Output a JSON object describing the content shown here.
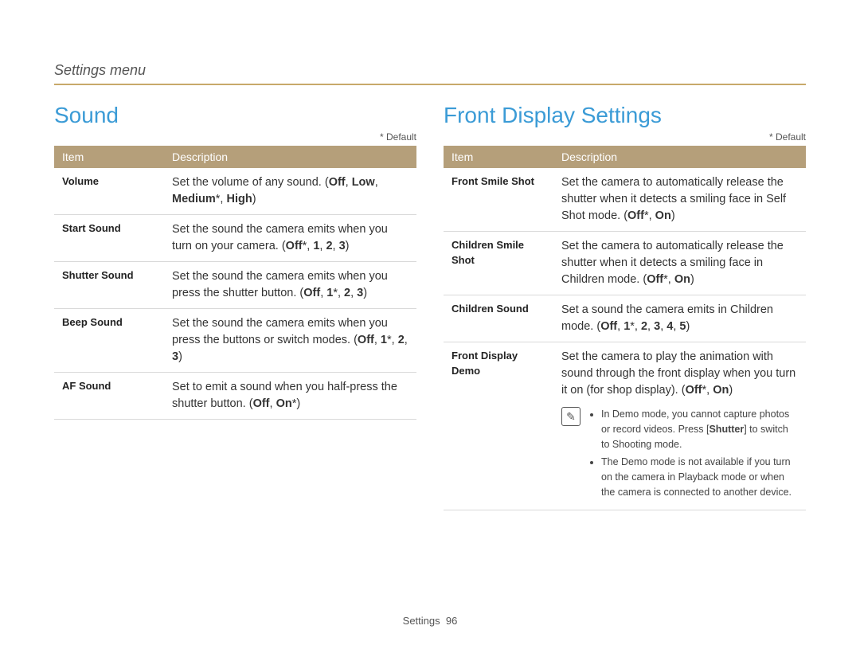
{
  "breadcrumb": "Settings menu",
  "default_note": "* Default",
  "table_headers": {
    "item": "Item",
    "description": "Description"
  },
  "left": {
    "title": "Sound",
    "rows": [
      {
        "item": "Volume",
        "desc_plain": "Set the volume of any sound. ",
        "opts_html": "(<b>Off</b>, <b>Low</b>, <b>Medium</b>*, <b>High</b>)"
      },
      {
        "item": "Start Sound",
        "desc_plain": "Set the sound the camera emits when you turn on your camera. ",
        "opts_html": "(<b>Off</b>*, <b>1</b>, <b>2</b>, <b>3</b>)"
      },
      {
        "item": "Shutter Sound",
        "desc_plain": "Set the sound the camera emits when you press the shutter button. ",
        "opts_html": "(<b>Off</b>, <b>1</b>*, <b>2</b>, <b>3</b>)"
      },
      {
        "item": "Beep Sound",
        "desc_plain": "Set the sound the camera emits when you press the buttons or switch modes. ",
        "opts_html": "(<b>Off</b>, <b>1</b>*, <b>2</b>, <b>3</b>)"
      },
      {
        "item": "AF Sound",
        "desc_plain": "Set to emit a sound when you half-press the shutter button. ",
        "opts_html": "(<b>Off</b>, <b>On</b>*)"
      }
    ]
  },
  "right": {
    "title": "Front Display Settings",
    "rows": [
      {
        "item": "Front Smile Shot",
        "desc_plain": "Set the camera to automatically release the shutter when it detects a smiling face in Self Shot mode. ",
        "opts_html": "(<b>Off</b>*, <b>On</b>)"
      },
      {
        "item": "Children Smile Shot",
        "desc_plain": "Set the camera to automatically release the shutter when it detects a smiling face in Children mode. ",
        "opts_html": "(<b>Off</b>*, <b>On</b>)"
      },
      {
        "item": "Children Sound",
        "desc_plain": "Set a sound the camera emits in Children mode. ",
        "opts_html": "(<b>Off</b>, <b>1</b>*, <b>2</b>, <b>3</b>, <b>4</b>, <b>5</b>)"
      },
      {
        "item": "Front Display Demo",
        "desc_plain": "Set the camera to play the animation with sound through the front display when you turn it on (for shop display). ",
        "opts_html": "(<b>Off</b>*, <b>On</b>)",
        "notes_html": [
          "In Demo mode, you cannot capture photos or record videos. Press [<b>Shutter</b>] to switch to Shooting mode.",
          "The Demo mode is not available if you turn on the camera in Playback mode or when the camera is connected to another device."
        ]
      }
    ]
  },
  "footer": {
    "label": "Settings",
    "page": "96"
  },
  "note_icon_char": "✎"
}
